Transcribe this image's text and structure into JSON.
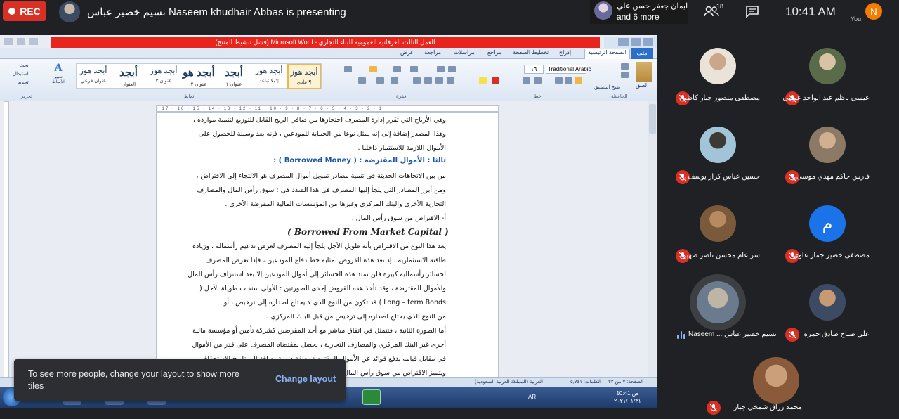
{
  "meeting": {
    "rec_label": "REC",
    "presenter_text": "نسيم خضير عباس Naseem khudhair Abbas is presenting",
    "participants_chip": {
      "line1": "ايمان جعفر حسن علي",
      "line2": "and 6 more"
    },
    "participant_count": "18",
    "clock": "10:41 AM",
    "you_initial": "N",
    "you_label": "You"
  },
  "word": {
    "title": "العمل الثالث الغرفانية العمومية للبناء التجاري - Microsoft Word (فشل تنشيط المنتج)",
    "tabs": [
      "ملف",
      "الصفحة الرئيسية",
      "إدراج",
      "تخطيط الصفحة",
      "مراجع",
      "مراسلات",
      "مراجعة",
      "عرض"
    ],
    "styles": [
      {
        "sample": "أبجد هوز",
        "name": "¶ عادي"
      },
      {
        "sample": "أبجد هوز",
        "name": "¶ بلا تباعد"
      },
      {
        "sample": "أبجد",
        "name": "عنوان ١"
      },
      {
        "sample": "أبجد هو",
        "name": "عنوان ٢"
      },
      {
        "sample": "أبجد هوز",
        "name": "عنوان ٣"
      },
      {
        "sample": "أبجد",
        "name": "العنوان"
      },
      {
        "sample": "أبجد هوز",
        "name": "عنوان فرعي"
      }
    ],
    "change_styles": "تغيير الأنماط",
    "editing": [
      "بحث",
      "استبدال",
      "تحديد"
    ],
    "group_labels": {
      "clipboard": "الحافظة",
      "font": "خط",
      "paragraph": "فقرة",
      "styles": "أنماط",
      "editing": "تحرير"
    },
    "font_name": "Traditional Arabic",
    "font_size": "١٦",
    "paste_label": "لصق",
    "copy_format": "نسخ التنسيق",
    "doc_lines": [
      "وهي الأرباح التي تقرر إدارة المصرف احتجازها من صافي الربح القابل للتوزيع لتنمية موارده ،",
      "وهذا المصدر إضافة إلى إنه يمثل نوعا من الحماية للمودعين ، فإنه يعد وسيلة للحصول على",
      "الأموال اللازمة للاستثمار داخليا .",
      "ثالثا : الأموال المقترضة : ( Borrowed Money ) :",
      "من بين الاتجاهات الحديثة في تنمية مصادر تمويل أموال المصرف هو الالتجاء إلى الاقتراض ،",
      "ومن أبرز المصادر التي يلجأ إليها المصرف في هذا الصدد هي : سوق رأس المال والمصارف",
      "التجارية الأخرى والبنك المركزي وغيرها من المؤسسات المالية المقرضة الأخرى .",
      "أ- الاقتراض من سوق رأس المال :",
      "( Borrowed From Market Capital )",
      "يعد هذا النوع من الاقتراض بأنه طويل الأجل يلجأ إليه المصرف لغرض تدعيم رأسماله ، وزيادة",
      "طاقته الاستثمارية ، إذ تعد هذه القروض بمثابة خط دفاع للمودعين ، فإذا تعرض المصرف",
      "لخسائر رأسمالية كبيرة فلن تمتد هذه الخسائر إلى أموال المودعين إلا بعد استنزاف رأس المال",
      "والأموال المقترضة ، وقد تأخذ هذه القروض إحدى الصورتين : الأولى سندات طويلة الأجل (",
      "Long – term Bonds ) قد تكون من النوع الذي لا يحتاج اصداره إلى ترخيص ، أو",
      "من النوع الذي يحتاج اصداره إلى ترخيص من قبل البنك المركزي .",
      "أما الصورة الثانية ، فتتمثل في اتفاق مباشر مع أحد المقرضين كشركة تأمين أو مؤسسة مالية",
      "أخرى غير البنك المركزي والمصارف التجارية ، يحصل بمقتضاه المصرف على قدر من الأموال",
      "في مقابل قيامه بدفع فوائد عن الأموال المقترضة بصفة دورية إضافة إلى تاريخ الاستحقاق .",
      "ويتميز الاقتراض من سوق رأس المال"
    ],
    "status": {
      "page": "الصفحة: ٧ من ٢٢",
      "words": "الكلمات: ٥,٧٤١",
      "language": "العربية (المملكة العربية السعودية)"
    },
    "taskbar_lang": "AR",
    "taskbar_time": "10:41 ص",
    "taskbar_date": "٢٠٢١/٠١/٣١"
  },
  "toast": {
    "text": "To see more people, change your layout to show more tiles",
    "button": "Change layout"
  },
  "tiles": [
    {
      "name": "عيسى ناظم عبد الواحد عيسى",
      "avatar_color": "#5a6b4a"
    },
    {
      "name": "مصطفى منصور جبار كاظم",
      "avatar_color": "#e9e3da"
    },
    {
      "name": "فارس حاكم مهدي موسى",
      "avatar_color": "#8c7a66"
    },
    {
      "name": "حسين عباس كزار يوسف",
      "avatar_color": "#a1c4d9"
    },
    {
      "name": "مصطفى خضير جماز عاوي",
      "avatar_color": "#1a73e8",
      "initial": "م"
    },
    {
      "name": "سر عام محسن ناصر صهيود",
      "avatar_color": "#7b5a3c"
    },
    {
      "name": "علي صباح صادق حمزه",
      "avatar_color": "#3c4b63"
    },
    {
      "name": "Naseem ... نسيم خضير عباس",
      "avatar_color": "#bfb5a4"
    },
    {
      "name": "محمد رزاق شمخي جبار",
      "avatar_color": "#8a5a3a"
    }
  ]
}
